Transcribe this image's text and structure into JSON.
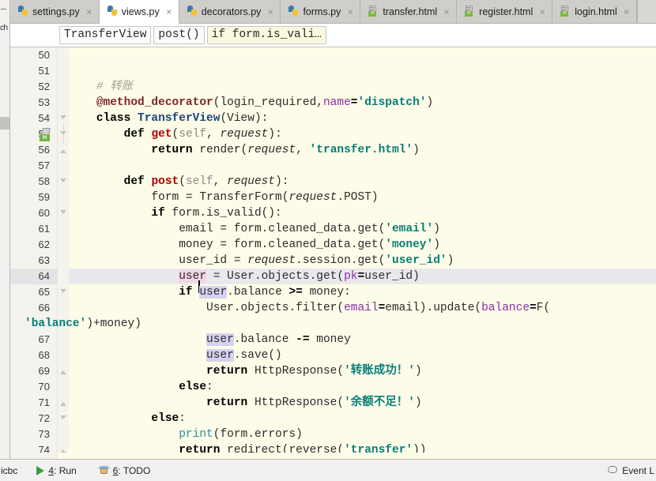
{
  "window": {
    "left_strip_label": "ch",
    "app_accent": "#3c78aa"
  },
  "tabs": [
    {
      "label": "settings.py",
      "icon": "python-file-icon",
      "active": false
    },
    {
      "label": "views.py",
      "icon": "python-file-icon",
      "active": true
    },
    {
      "label": "decorators.py",
      "icon": "python-file-icon",
      "active": false
    },
    {
      "label": "forms.py",
      "icon": "python-file-icon",
      "active": false
    },
    {
      "label": "transfer.html",
      "icon": "html-file-icon",
      "active": false
    },
    {
      "label": "register.html",
      "icon": "html-file-icon",
      "active": false
    },
    {
      "label": "login.html",
      "icon": "html-file-icon",
      "active": false
    }
  ],
  "tab_close_glyph": "×",
  "breadcrumb": {
    "items": [
      {
        "label": "TransferView",
        "highlighted": false
      },
      {
        "label": "post()",
        "highlighted": false
      },
      {
        "label": "if form.is_vali…",
        "highlighted": true
      }
    ]
  },
  "editor": {
    "first_line": 50,
    "current_line": 64,
    "lines": [
      {
        "n": 50,
        "text": ""
      },
      {
        "n": 51,
        "text": ""
      },
      {
        "n": 52,
        "text": "    # 转账"
      },
      {
        "n": 53,
        "text": "    @method_decorator(login_required, name='dispatch')"
      },
      {
        "n": 54,
        "text": "    class TransferView(View):"
      },
      {
        "n": 55,
        "text": "        def get(self, request):"
      },
      {
        "n": 56,
        "text": "            return render(request, 'transfer.html')"
      },
      {
        "n": 57,
        "text": ""
      },
      {
        "n": 58,
        "text": "        def post(self, request):"
      },
      {
        "n": 59,
        "text": "            form = TransferForm(request.POST)"
      },
      {
        "n": 60,
        "text": "            if form.is_valid():"
      },
      {
        "n": 61,
        "text": "                email = form.cleaned_data.get('email')"
      },
      {
        "n": 62,
        "text": "                money = form.cleaned_data.get('money')"
      },
      {
        "n": 63,
        "text": "                user_id = request.session.get('user_id')"
      },
      {
        "n": 64,
        "text": "                user = User.objects.get(pk=user_id)"
      },
      {
        "n": 65,
        "text": "                if user.balance >= money:"
      },
      {
        "n": 66,
        "text": "                    User.objects.filter(email=email).update(balance=F('balance')+money)"
      },
      {
        "n": 67,
        "text": "                    user.balance -= money"
      },
      {
        "n": 68,
        "text": "                    user.save()"
      },
      {
        "n": 69,
        "text": "                    return HttpResponse('转账成功！')"
      },
      {
        "n": 70,
        "text": "                else:"
      },
      {
        "n": 71,
        "text": "                    return HttpResponse('余额不足！')"
      },
      {
        "n": 72,
        "text": "            else:"
      },
      {
        "n": 73,
        "text": "                print(form.errors)"
      },
      {
        "n": 74,
        "text": "                return redirect(reverse('transfer'))"
      }
    ],
    "gutter_icon_line": 55,
    "gutter_icon_name": "html-run-target-icon",
    "gutter_icon_label": "H"
  },
  "statusbar": {
    "left_label": "icbc",
    "run_number": "4",
    "run_label": ": Run",
    "todo_number": "6",
    "todo_label": ": TODO",
    "event_label": "Event L"
  },
  "watermark": {
    "text": "https://blog.csdn.net/whalescde"
  }
}
